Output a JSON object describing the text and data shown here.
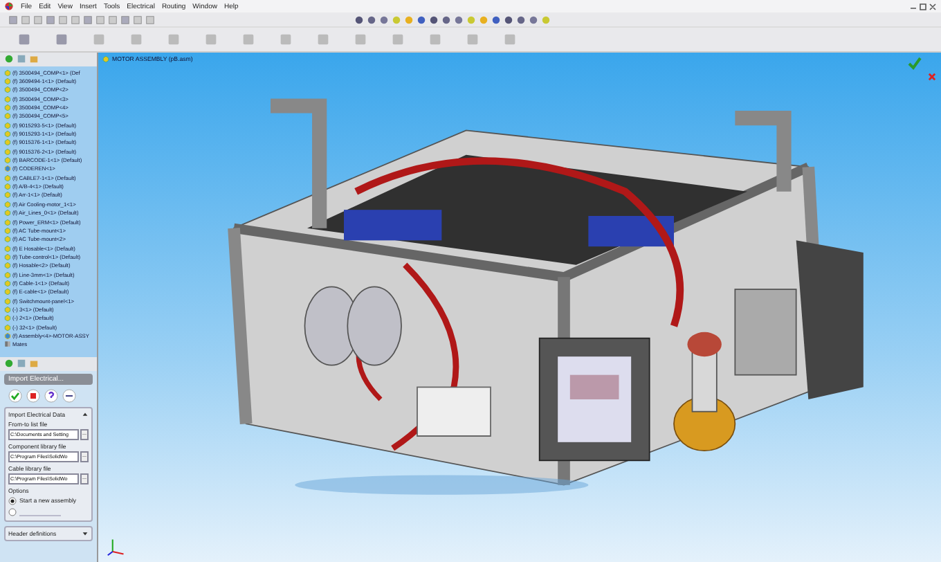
{
  "menu": [
    "File",
    "Edit",
    "View",
    "Insert",
    "Tools",
    "Electrical",
    "Routing",
    "Window",
    "Help"
  ],
  "tree": {
    "items": [
      {
        "label": "(f) 3500494_COMP<1> (Def",
        "kind": "part"
      },
      {
        "label": "(f) 3609494-1<1> (Default)",
        "kind": "part"
      },
      {
        "label": "(f) 3500494_COMP<2>",
        "kind": "part"
      },
      {
        "label": "(f) 3500494_COMP<3>",
        "kind": "part"
      },
      {
        "label": "(f) 3500494_COMP<4>",
        "kind": "part"
      },
      {
        "label": "(f) 3500494_COMP<5>",
        "kind": "part"
      },
      {
        "label": "(f) 9015293-5<1> (Default)",
        "kind": "part"
      },
      {
        "label": "(f) 9015293-1<1> (Default)",
        "kind": "part"
      },
      {
        "label": "(f) 9015376-1<1> (Default)",
        "kind": "part"
      },
      {
        "label": "(f) 9015376-2<1> (Default)",
        "kind": "part"
      },
      {
        "label": "(f) BARCODE-1<1> (Default)",
        "kind": "part"
      },
      {
        "label": "(f) CODEREN<1>",
        "kind": "assembly"
      },
      {
        "label": "(f) CABLE7-1<1> (Default)",
        "kind": "part"
      },
      {
        "label": "(f) A/B-4<1> (Default)",
        "kind": "part"
      },
      {
        "label": "(f) Arr-1<1> (Default)",
        "kind": "part"
      },
      {
        "label": "(f) Air Cooling-motor_1<1>",
        "kind": "part"
      },
      {
        "label": "(f) Air_Lines_0<1> (Default)",
        "kind": "part"
      },
      {
        "label": "(f) Power_ERM<1> (Default)",
        "kind": "part"
      },
      {
        "label": "(f) AC Tube-mount<1>",
        "kind": "part"
      },
      {
        "label": "(f) AC Tube-mount<2>",
        "kind": "part"
      },
      {
        "label": "(f) E Hosable<1> (Default)",
        "kind": "part"
      },
      {
        "label": "(f) Tube-control<1> (Default)",
        "kind": "part"
      },
      {
        "label": "(f) Hosable<2> (Default)",
        "kind": "part"
      },
      {
        "label": "(f) Line-3mm<1> (Default)",
        "kind": "part"
      },
      {
        "label": "(f) Cable-1<1> (Default)",
        "kind": "part"
      },
      {
        "label": "(f) E-cable<1> (Default)",
        "kind": "part"
      },
      {
        "label": "(f) Switchmount-panel<1>",
        "kind": "part"
      },
      {
        "label": "(-) 3<1> (Default)",
        "kind": "part"
      },
      {
        "label": "(-) 2<1> (Default)",
        "kind": "part"
      },
      {
        "label": "(-) 32<1> (Default)",
        "kind": "part"
      },
      {
        "label": "(f) Assembly<4>-MOTOR-ASSY",
        "kind": "assembly"
      },
      {
        "label": "Mates",
        "kind": "mates"
      }
    ]
  },
  "property_manager": {
    "title": "Import Electrical...",
    "section": {
      "title": "Import Electrical Data",
      "expanded": true,
      "fields": [
        {
          "label": "From-to list file",
          "value": "C:\\Documents and Setting",
          "browse": "..."
        },
        {
          "label": "Component library file",
          "value": "C:\\Program Files\\SolidWo",
          "browse": "..."
        },
        {
          "label": "Cable library file",
          "value": "C:\\Program Files\\SolidWo",
          "browse": "..."
        }
      ],
      "options_label": "Options",
      "options": [
        {
          "label": "Start a new assembly",
          "selected": true
        },
        {
          "selected": false
        }
      ]
    },
    "collapsed_section": {
      "title": "Header definitions",
      "expanded": false
    }
  },
  "viewport": {
    "title": "MOTOR ASSEMBLY (pB.asm)"
  }
}
